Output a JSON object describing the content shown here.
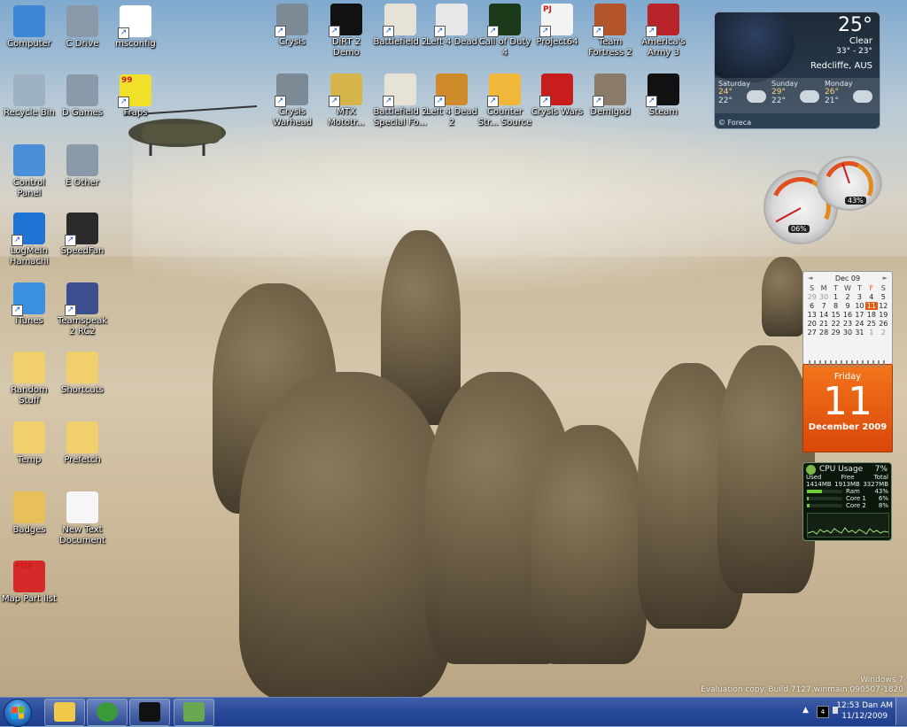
{
  "desktop": {
    "icons": [
      {
        "label": "Computer",
        "icon": "computer-icon",
        "color": "#3f86d6"
      },
      {
        "label": "C Drive",
        "icon": "drive-icon",
        "color": "#8a9aa8"
      },
      {
        "label": "msconfig",
        "icon": "msconfig-icon",
        "color": "#ffffff"
      },
      {
        "label": "Recycle Bin",
        "icon": "recycle-bin-icon",
        "color": "#9fb2c4"
      },
      {
        "label": "D Games",
        "icon": "drive-icon",
        "color": "#8a9aa8"
      },
      {
        "label": "Fraps",
        "icon": "fraps-icon",
        "color": "#f1e02a",
        "badge": "99"
      },
      {
        "label": "Control Panel",
        "icon": "control-panel-icon",
        "color": "#4a8fd8"
      },
      {
        "label": "E Other",
        "icon": "drive-icon",
        "color": "#8a9aa8"
      },
      {
        "label": "LogMeIn Hamachi",
        "icon": "hamachi-icon",
        "color": "#1f74d6"
      },
      {
        "label": "SpeedFan",
        "icon": "speedfan-icon",
        "color": "#2a2a2a"
      },
      {
        "label": "iTunes",
        "icon": "itunes-icon",
        "color": "#3a8fe0"
      },
      {
        "label": "Teamspeak 2 RC2",
        "icon": "teamspeak-icon",
        "color": "#3b4f8f"
      },
      {
        "label": "Random Stuff",
        "icon": "folder-icon",
        "color": "#f0cf6c"
      },
      {
        "label": "Shortcuts",
        "icon": "folder-icon",
        "color": "#f0cf6c"
      },
      {
        "label": "Temp",
        "icon": "folder-icon",
        "color": "#f0cf6c"
      },
      {
        "label": "Prefetch",
        "icon": "folder-icon",
        "color": "#f0cf6c"
      },
      {
        "label": "Badges",
        "icon": "folder-icon",
        "color": "#e8c05a"
      },
      {
        "label": "New Text Document",
        "icon": "text-document-icon",
        "color": "#f6f6f6"
      },
      {
        "label": "Map Part list",
        "icon": "pdf-icon",
        "color": "#d62a2a",
        "badge": "PDF"
      },
      {
        "label": "Crysis",
        "icon": "crysis-icon",
        "color": "#7c8a96"
      },
      {
        "label": "DiRT 2 Demo",
        "icon": "dirt2-icon",
        "color": "#111111"
      },
      {
        "label": "Battlefield 2",
        "icon": "battlefield2-icon",
        "color": "#e7e2d6"
      },
      {
        "label": "Left 4 Dead",
        "icon": "left4dead-icon",
        "color": "#e7e7e7"
      },
      {
        "label": "Call of Duty 4",
        "icon": "cod4-icon",
        "color": "#1a3a1a"
      },
      {
        "label": "Project64",
        "icon": "project64-icon",
        "color": "#f3f3f3",
        "badge": "PJ"
      },
      {
        "label": "Team Fortress 2",
        "icon": "tf2-icon",
        "color": "#b3542a"
      },
      {
        "label": "America's Army 3",
        "icon": "americas-army-icon",
        "color": "#b9232a"
      },
      {
        "label": "Crysis Warhead",
        "icon": "crysis-icon",
        "color": "#7c8a96"
      },
      {
        "label": "MTX Mototr...",
        "icon": "mtx-icon",
        "color": "#d5b44a"
      },
      {
        "label": "Battlefield 2 Special Fo...",
        "icon": "battlefield2-icon",
        "color": "#e7e2d6"
      },
      {
        "label": "Left 4 Dead 2",
        "icon": "left4dead-icon",
        "color": "#cf8a2a"
      },
      {
        "label": "Counter Str... Source",
        "icon": "counter-strike-icon",
        "color": "#f0b73a"
      },
      {
        "label": "Crysis Wars",
        "icon": "crysis-wars-icon",
        "color": "#c81d1d"
      },
      {
        "label": "Demigod",
        "icon": "demigod-icon",
        "color": "#8a7a6a"
      },
      {
        "label": "Steam",
        "icon": "steam-icon",
        "color": "#111111"
      }
    ]
  },
  "weather": {
    "temperature": "25°",
    "condition": "Clear",
    "hilo": "33° - 23°",
    "location": "Redcliffe, AUS",
    "forecast": [
      {
        "day": "Saturday",
        "hi": "24°",
        "lo": "22°"
      },
      {
        "day": "Sunday",
        "hi": "29°",
        "lo": "22°"
      },
      {
        "day": "Monday",
        "hi": "26°",
        "lo": "21°"
      }
    ],
    "brand": "© Foreca"
  },
  "meters": {
    "cpu_readout": "06%",
    "memory_readout": "43%",
    "cpu_value": 0.06,
    "memory_value": 0.43
  },
  "calendar": {
    "month_label": "Dec 09",
    "prev": "◄",
    "next": "►",
    "weekdays": [
      "S",
      "M",
      "T",
      "W",
      "T",
      "F",
      "S"
    ],
    "days": [
      {
        "d": "29",
        "muted": true
      },
      {
        "d": "30",
        "muted": true
      },
      {
        "d": "1"
      },
      {
        "d": "2"
      },
      {
        "d": "3"
      },
      {
        "d": "4"
      },
      {
        "d": "5"
      },
      {
        "d": "6"
      },
      {
        "d": "7"
      },
      {
        "d": "8"
      },
      {
        "d": "9"
      },
      {
        "d": "10"
      },
      {
        "d": "11",
        "today": true
      },
      {
        "d": "12"
      },
      {
        "d": "13"
      },
      {
        "d": "14"
      },
      {
        "d": "15"
      },
      {
        "d": "16"
      },
      {
        "d": "17"
      },
      {
        "d": "18"
      },
      {
        "d": "19"
      },
      {
        "d": "20"
      },
      {
        "d": "21"
      },
      {
        "d": "22"
      },
      {
        "d": "23"
      },
      {
        "d": "24"
      },
      {
        "d": "25"
      },
      {
        "d": "26"
      },
      {
        "d": "27"
      },
      {
        "d": "28"
      },
      {
        "d": "29"
      },
      {
        "d": "30"
      },
      {
        "d": "31"
      },
      {
        "d": "1",
        "muted": true
      },
      {
        "d": "2",
        "muted": true
      }
    ],
    "day_of_week": "Friday",
    "day_number": "11",
    "month_year": "December 2009",
    "accent": "#e55b10"
  },
  "cpu_gadget": {
    "title": "CPU Usage",
    "percent": "7%",
    "headers": [
      "Used",
      "Free",
      "Total"
    ],
    "values": [
      "1414MB",
      "1913MB",
      "3327MB"
    ],
    "ram_label": "Ram",
    "ram_pct": "43%",
    "ram_value": 0.43,
    "core1_label": "Core 1",
    "core1_pct": "6%",
    "core1_value": 0.06,
    "core2_label": "Core 2",
    "core2_pct": "8%",
    "core2_value": 0.08
  },
  "watermark": {
    "line1": "Windows 7",
    "line2": "Evaluation copy. Build 7127.winmain.090507-1820"
  },
  "taskbar": {
    "pinned": [
      {
        "name": "explorer-icon",
        "color": "#f0c84a"
      },
      {
        "name": "chrome-icon",
        "color": "#3a9a3a"
      },
      {
        "name": "steam-icon",
        "color": "#111111"
      },
      {
        "name": "hamachi-icon",
        "color": "#6aa84f"
      }
    ],
    "tray_chevron": "▲",
    "network_label": "4",
    "clock_time": "12:53 Dan AM",
    "clock_date": "11/12/2009"
  }
}
